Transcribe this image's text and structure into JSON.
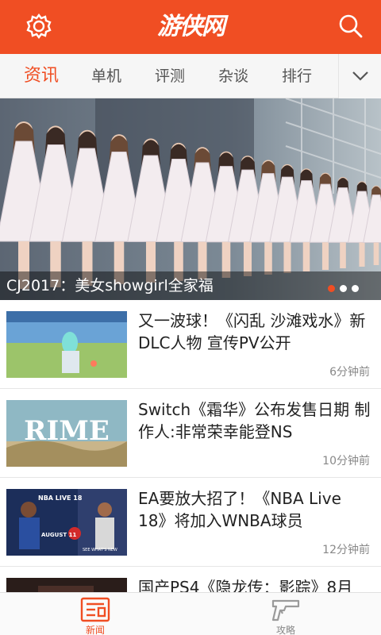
{
  "app": {
    "logo_text": "游侠网",
    "accent": "#f04e23",
    "icons": {
      "settings": "gear-icon",
      "search": "search-icon",
      "more": "chevron-down-icon"
    }
  },
  "tabs": [
    {
      "label": "资讯",
      "active": true
    },
    {
      "label": "单机",
      "active": false
    },
    {
      "label": "评测",
      "active": false
    },
    {
      "label": "杂谈",
      "active": false
    },
    {
      "label": "排行",
      "active": false
    }
  ],
  "banner": {
    "caption": "CJ2017：美女showgirl全家福",
    "slides_total": 3,
    "active_slide": 1
  },
  "news": [
    {
      "title": "又一波球！《闪乱 沙滩戏水》新DLC人物 宣传PV公开",
      "time": "6分钟前"
    },
    {
      "title": "Switch《霜华》公布发售日期 制作人:非常荣幸能登NS",
      "time": "10分钟前",
      "thumb_text": "RIME"
    },
    {
      "title": "EA要放大招了！《NBA Live 18》将加入WNBA球员",
      "time": "12分钟前",
      "thumb_text": "NBA LIVE 18",
      "thumb_sub": "AUGUST 11",
      "thumb_sub2": "SEE WHAT'S NEW"
    },
    {
      "title": "国产PS4《隐龙传：影踪》8月",
      "time": ""
    }
  ],
  "bottom_nav": [
    {
      "label": "新闻",
      "active": true,
      "icon": "newspaper-icon"
    },
    {
      "label": "攻略",
      "active": false,
      "icon": "gun-icon"
    }
  ]
}
